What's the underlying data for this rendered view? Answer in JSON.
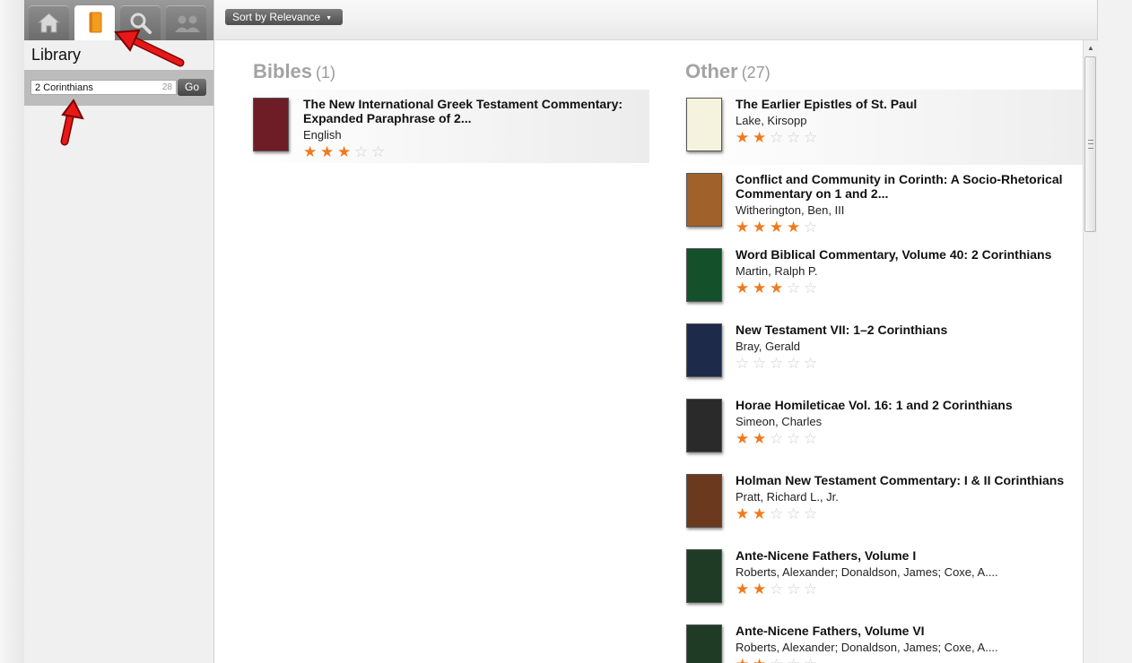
{
  "nav": {
    "tabs": [
      {
        "id": "home",
        "icon": "home-icon",
        "active": false
      },
      {
        "id": "library",
        "icon": "book-icon",
        "active": true
      },
      {
        "id": "search",
        "icon": "search-icon",
        "active": false
      },
      {
        "id": "community",
        "icon": "people-icon",
        "active": false
      }
    ]
  },
  "sidebar": {
    "title": "Library",
    "search_value": "2 Corinthians",
    "result_count": "28",
    "go_label": "Go"
  },
  "toolbar": {
    "sort_label": "Sort by Relevance",
    "sort_caret": "▼"
  },
  "columns": {
    "bibles": {
      "heading": "Bibles",
      "count": "(1)"
    },
    "other": {
      "heading": "Other",
      "count": "(27)"
    }
  },
  "colors": {
    "star_filled": "#f07a1d",
    "star_empty": "#d0d0d0",
    "active_tab_icon": "#f39c1e"
  },
  "bibles_results": [
    {
      "title": "The New International Greek Testament Commentary: Expanded Paraphrase of 2...",
      "subtitle": "English",
      "rating": 3,
      "cover_color": "#6e1d26"
    }
  ],
  "other_results": [
    {
      "title": "The Earlier Epistles of St. Paul",
      "author": "Lake, Kirsopp",
      "rating": 2,
      "cover_color": "#f5f3dd"
    },
    {
      "title": "Conflict and Community in Corinth: A Socio-Rhetorical Commentary on 1 and 2...",
      "author": "Witherington, Ben, III",
      "rating": 4,
      "cover_color": "#a0622a"
    },
    {
      "title": "Word Biblical Commentary, Volume 40: 2 Corinthians",
      "author": "Martin, Ralph P.",
      "rating": 3,
      "cover_color": "#14502a"
    },
    {
      "title": "New Testament VII: 1–2 Corinthians",
      "author": "Bray, Gerald",
      "rating": 0,
      "cover_color": "#1e2a4a"
    },
    {
      "title": "Horae Homileticae Vol. 16: 1 and 2 Corinthians",
      "author": "Simeon, Charles",
      "rating": 2,
      "cover_color": "#2a2a2a"
    },
    {
      "title": "Holman New Testament Commentary: I & II Corinthians",
      "author": "Pratt, Richard L., Jr.",
      "rating": 2,
      "cover_color": "#6b3a1e"
    },
    {
      "title": "Ante-Nicene Fathers, Volume I",
      "author": "Roberts, Alexander; Donaldson, James; Coxe, A....",
      "rating": 2,
      "cover_color": "#1f3b26"
    },
    {
      "title": "Ante-Nicene Fathers, Volume VI",
      "author": "Roberts, Alexander; Donaldson, James; Coxe, A....",
      "rating": 2,
      "cover_color": "#1f3b26"
    }
  ]
}
